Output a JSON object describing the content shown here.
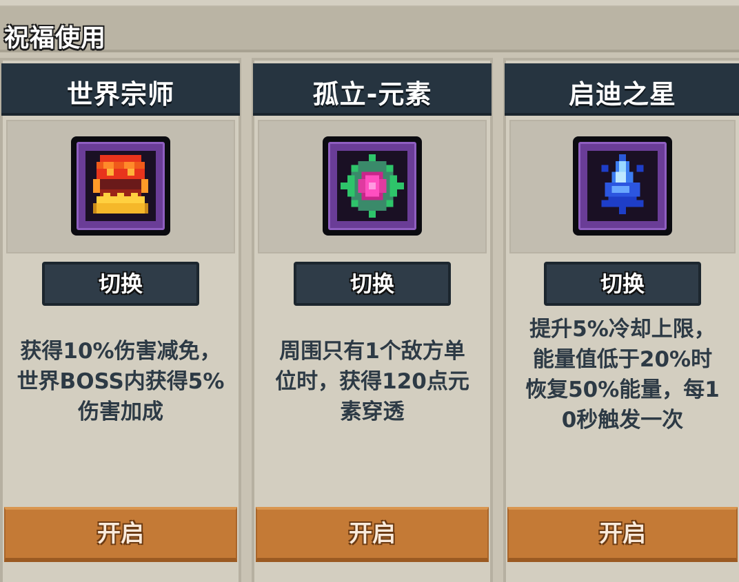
{
  "header": {
    "title": "祝福使用"
  },
  "cards": [
    {
      "title": "世界宗师",
      "icon": "fire-chest-icon",
      "switch_label": "切换",
      "description": [
        "获得10%伤害减免，",
        "世界BOSS内获得5%",
        "伤害加成"
      ],
      "open_label": "开启"
    },
    {
      "title": "孤立-元素",
      "icon": "element-gem-icon",
      "switch_label": "切换",
      "description": [
        "周围只有1个敌方单",
        "位时，获得120点元",
        "素穿透"
      ],
      "open_label": "开启"
    },
    {
      "title": "启迪之星",
      "icon": "blue-star-icon",
      "switch_label": "切换",
      "description": [
        "提升5%冷却上限，",
        "能量值低于20%时",
        "恢复50%能量，每1",
        "0秒触发一次"
      ],
      "open_label": "开启"
    }
  ],
  "colors": {
    "background": "#c9c3b4",
    "title_bar": "#263440",
    "switch_button": "#2f3c48",
    "open_button": "#c47a36",
    "description_text": "#2d3a45"
  }
}
